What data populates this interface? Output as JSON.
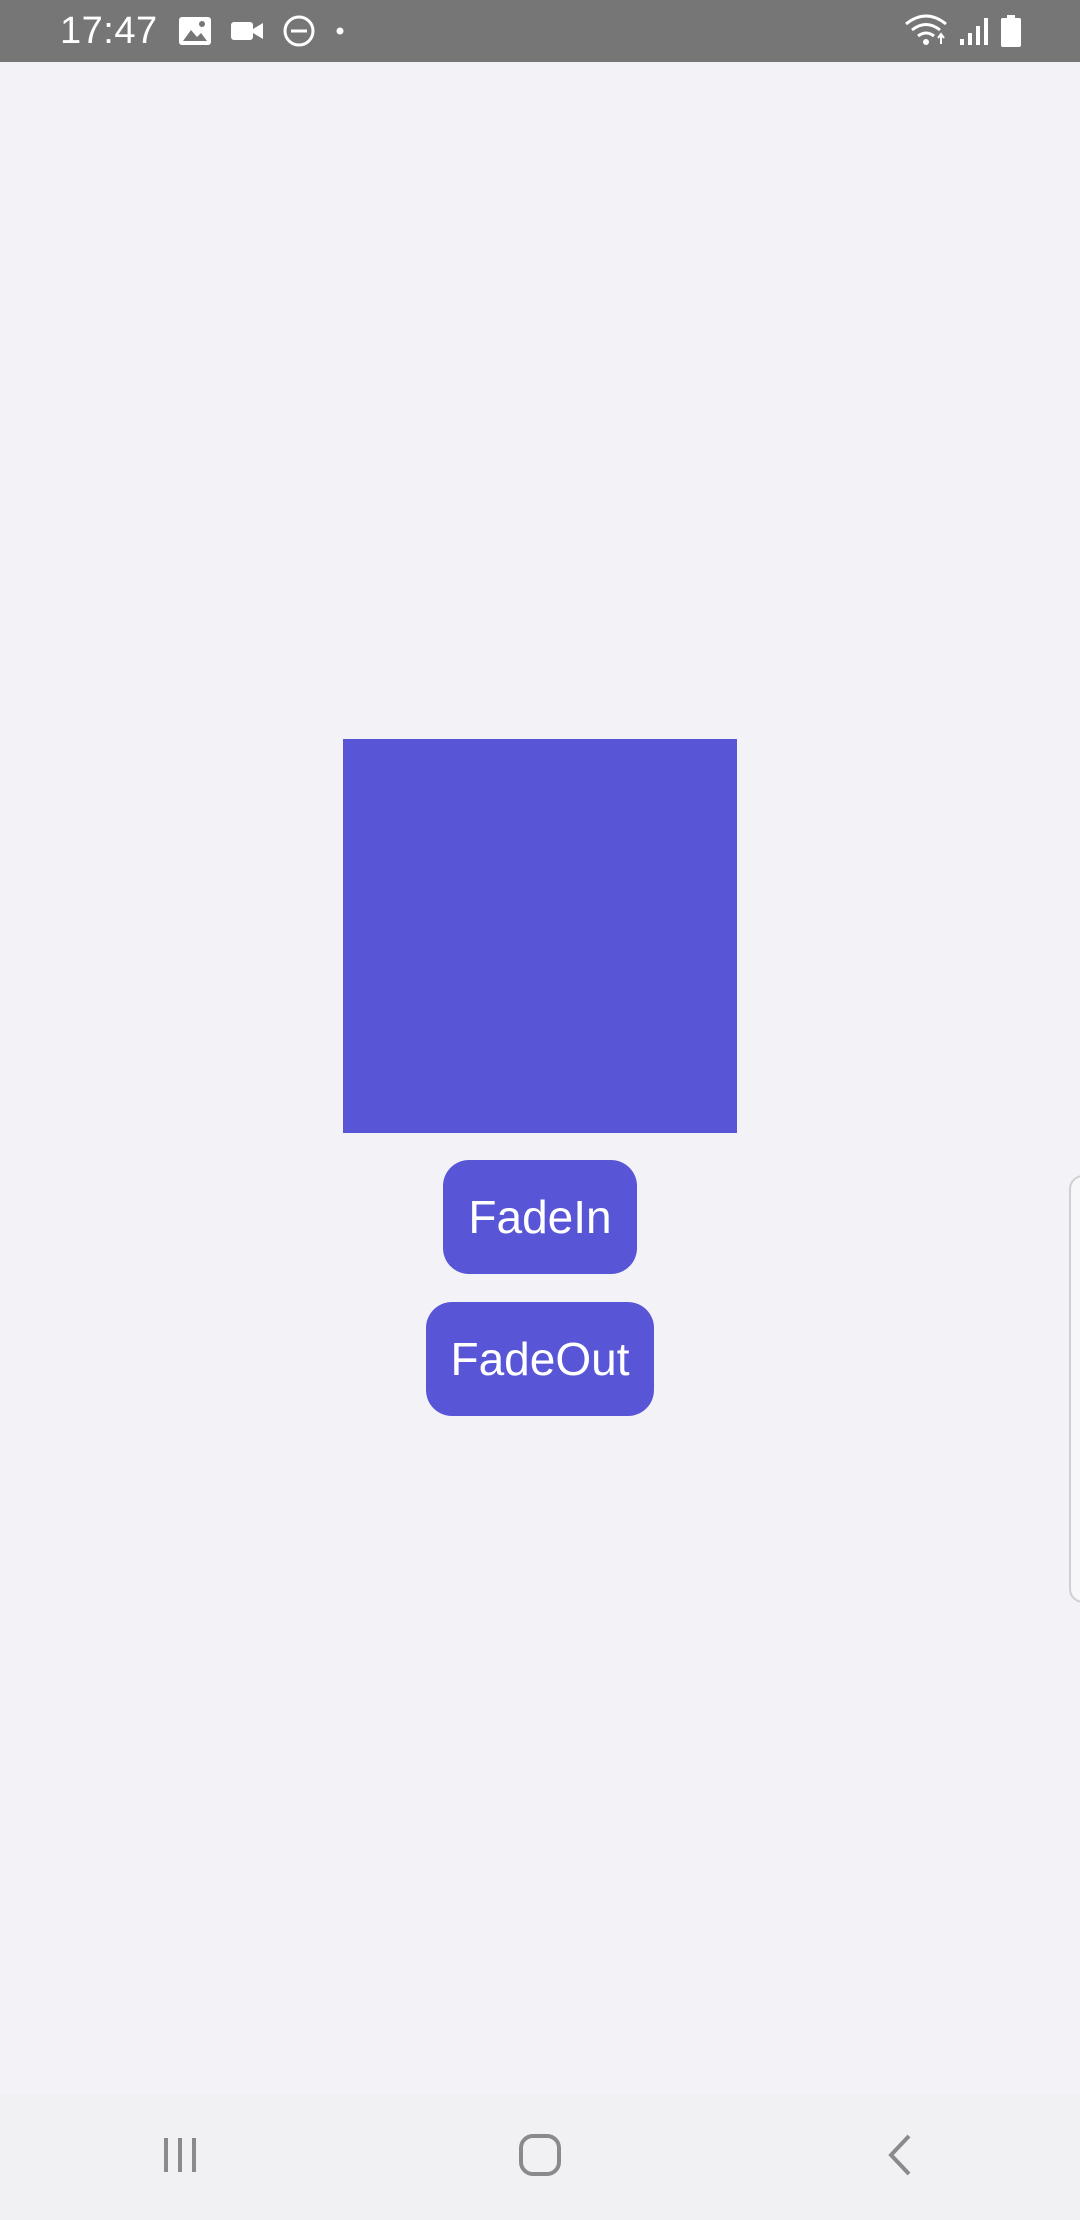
{
  "status_bar": {
    "time": "17:47",
    "left_icons": [
      "image-icon",
      "video-camera-icon",
      "do-not-disturb-icon",
      "dot-icon"
    ],
    "right_icons": [
      "wifi-icon",
      "signal-icon",
      "battery-icon"
    ]
  },
  "main": {
    "box_color": "#5856d6",
    "buttons": {
      "fade_in_label": "FadeIn",
      "fade_out_label": "FadeOut"
    }
  },
  "nav_bar": {
    "icons": [
      "recent-apps-icon",
      "home-icon",
      "back-icon"
    ]
  },
  "colors": {
    "accent": "#5856d6",
    "background": "#f3f2f7",
    "status_bar": "#767676"
  }
}
